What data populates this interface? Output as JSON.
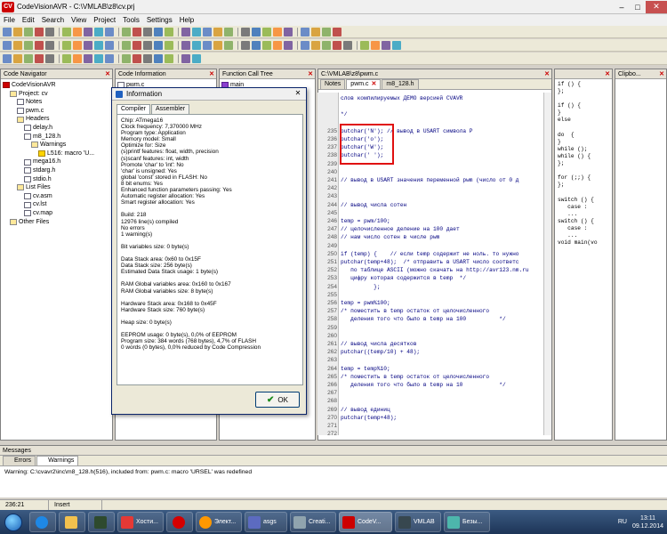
{
  "window": {
    "title": "CodeVisionAVR - C:\\VMLAB\\z8\\cv.prj",
    "logo_text": "CV"
  },
  "menu": [
    "File",
    "Edit",
    "Search",
    "View",
    "Project",
    "Tools",
    "Settings",
    "Help"
  ],
  "navigator": {
    "header": "Code Navigator",
    "items": [
      {
        "label": "CodeVisionAVR",
        "depth": 0,
        "icon": "red"
      },
      {
        "label": "Project: cv",
        "depth": 1,
        "icon": "folder"
      },
      {
        "label": "Notes",
        "depth": 2,
        "icon": "file"
      },
      {
        "label": "pwm.c",
        "depth": 2,
        "icon": "file"
      },
      {
        "label": "Headers",
        "depth": 2,
        "icon": "folder"
      },
      {
        "label": "delay.h",
        "depth": 3,
        "icon": "file"
      },
      {
        "label": "m8_128.h",
        "depth": 3,
        "icon": "file"
      },
      {
        "label": "Warnings",
        "depth": 4,
        "icon": "folder"
      },
      {
        "label": "L516: macro 'U...",
        "depth": 5,
        "icon": "warn"
      },
      {
        "label": "mega16.h",
        "depth": 3,
        "icon": "file"
      },
      {
        "label": "stdarg.h",
        "depth": 3,
        "icon": "file"
      },
      {
        "label": "stdio.h",
        "depth": 3,
        "icon": "file"
      },
      {
        "label": "List Files",
        "depth": 2,
        "icon": "folder"
      },
      {
        "label": "cv.asm",
        "depth": 3,
        "icon": "file"
      },
      {
        "label": "cv.lst",
        "depth": 3,
        "icon": "file"
      },
      {
        "label": "cv.map",
        "depth": 3,
        "icon": "file"
      },
      {
        "label": "Other Files",
        "depth": 1,
        "icon": "folder"
      }
    ]
  },
  "code_info": {
    "header": "Code Information",
    "items": [
      "pwm.c"
    ]
  },
  "call_tree": {
    "header": "Function Call Tree",
    "items": [
      "main"
    ]
  },
  "editor": {
    "path": "C:\\VMLAB\\z8\\pwm.c",
    "tabs": [
      "Notes",
      "pwm.c",
      "m8_128.h"
    ],
    "lines": [
      {
        "n": "",
        "t": "слов компилируемых ДЕМО версией CVAVR"
      },
      {
        "n": "",
        "t": ""
      },
      {
        "n": "",
        "t": "*/"
      },
      {
        "n": "",
        "t": ""
      },
      {
        "n": "235",
        "t": "putchar('N'); // вывод в USART символа P"
      },
      {
        "n": "236",
        "t": "putchar('o');"
      },
      {
        "n": "237",
        "t": "putchar('W');"
      },
      {
        "n": "238",
        "t": "putchar(' ');"
      },
      {
        "n": "239",
        "t": ""
      },
      {
        "n": "240",
        "t": ""
      },
      {
        "n": "241",
        "t": "// вывод в USART значения переменной pwm (число от 0 д"
      },
      {
        "n": "242",
        "t": ""
      },
      {
        "n": "243",
        "t": ""
      },
      {
        "n": "244",
        "t": "// вывод числа сотен"
      },
      {
        "n": "245",
        "t": ""
      },
      {
        "n": "246",
        "t": "temp = pwm/100;"
      },
      {
        "n": "247",
        "t": "// целочисленное деление на 100 дает"
      },
      {
        "n": "248",
        "t": "// нам число сотен в числе pwm"
      },
      {
        "n": "249",
        "t": ""
      },
      {
        "n": "250",
        "t": "if (temp) {    // если temp содержит не ноль. то нужно"
      },
      {
        "n": "251",
        "t": "putchar(temp+48);  /* отправить в USART число соответс"
      },
      {
        "n": "252",
        "t": "   по таблице ASCII (можно скачать на http://avr123.nm.ru"
      },
      {
        "n": "253",
        "t": "   цифру которая содержится в temp  */"
      },
      {
        "n": "254",
        "t": "          };"
      },
      {
        "n": "255",
        "t": ""
      },
      {
        "n": "256",
        "t": "temp = pwm%100;"
      },
      {
        "n": "257",
        "t": "/* поместить в temp остаток от целочисленного"
      },
      {
        "n": "258",
        "t": "   деления того что было в temp на 100          */"
      },
      {
        "n": "259",
        "t": ""
      },
      {
        "n": "260",
        "t": ""
      },
      {
        "n": "261",
        "t": "// вывод числа десятков"
      },
      {
        "n": "262",
        "t": "putchar((temp/10) + 48);"
      },
      {
        "n": "263",
        "t": ""
      },
      {
        "n": "264",
        "t": "temp = temp%10;"
      },
      {
        "n": "265",
        "t": "/* поместить в temp остаток от целочисленного"
      },
      {
        "n": "266",
        "t": "   деления того что было в temp на 10           */"
      },
      {
        "n": "267",
        "t": ""
      },
      {
        "n": "268",
        "t": ""
      },
      {
        "n": "269",
        "t": "// вывод единиц"
      },
      {
        "n": "270",
        "t": "putchar(temp+48);"
      },
      {
        "n": "271",
        "t": ""
      },
      {
        "n": "272",
        "t": ""
      }
    ]
  },
  "side_panel": {
    "tab1": "",
    "tab2": "Clipbo...",
    "snippets": [
      "if () {",
      "};",
      "",
      "if () {",
      "}",
      "else",
      "",
      "do  {",
      "}",
      "while ();",
      "while () {",
      "};",
      "",
      "for (;;) {",
      "};",
      "",
      "switch () {",
      "   case :",
      "   ...",
      "switch () {",
      "   case :",
      "   ...",
      "void main(vo"
    ]
  },
  "dialog": {
    "title": "Information",
    "tabs": [
      "Compiler",
      "Assembler"
    ],
    "lines": [
      "Chip: ATmega16",
      "Clock frequency: 7,370000 MHz",
      "Program type: Application",
      "Memory model: Small",
      "Optimize for: Size",
      "(s)printf features: float, width, precision",
      "(s)scanf features: int, width",
      "Promote 'char' to 'int': No",
      "'char' is unsigned: Yes",
      "global 'const' stored in FLASH: No",
      "8 bit enums: Yes",
      "Enhanced function parameters passing: Yes",
      "Automatic register allocation: Yes",
      "Smart register allocation: Yes",
      "",
      "Build: 218",
      "12976 line(s) compiled",
      "No errors",
      "1 warning(s)",
      "",
      "Bit variables size: 0 byte(s)",
      "",
      "Data Stack area: 0x60 to 0x15F",
      "Data Stack size: 256 byte(s)",
      "Estimated Data Stack usage: 1 byte(s)",
      "",
      "RAM Global variables area: 0x160 to 0x167",
      "RAM Global variables size: 8 byte(s)",
      "",
      "Hardware Stack area: 0x168 to 0x45F",
      "Hardware Stack size: 760 byte(s)",
      "",
      "Heap size: 0 byte(s)",
      "",
      "EEPROM usage: 0 byte(s), 0,0% of EEPROM",
      "Program size: 384 words (768 bytes), 4,7% of FLASH",
      "0 words (0 bytes), 0,0% reduced by Code Compression"
    ],
    "ok_label": "OK"
  },
  "messages": {
    "header": "Messages",
    "tabs": [
      "Errors",
      "Warnings"
    ],
    "text": "Warning: C:\\cvavr2\\inc\\m8_128.h(516), included from: pwm.c: macro 'URSEL' was redefined"
  },
  "status": {
    "position": "236:21",
    "mode": "Insert"
  },
  "taskbar": {
    "buttons": [
      "",
      "",
      "",
      "Хости...",
      "",
      "Элект...",
      "asgs",
      "Creati...",
      "CodeV...",
      "VMLAB",
      "Безы..."
    ],
    "lang": "RU",
    "time": "13:11",
    "date": "09.12.2014"
  }
}
